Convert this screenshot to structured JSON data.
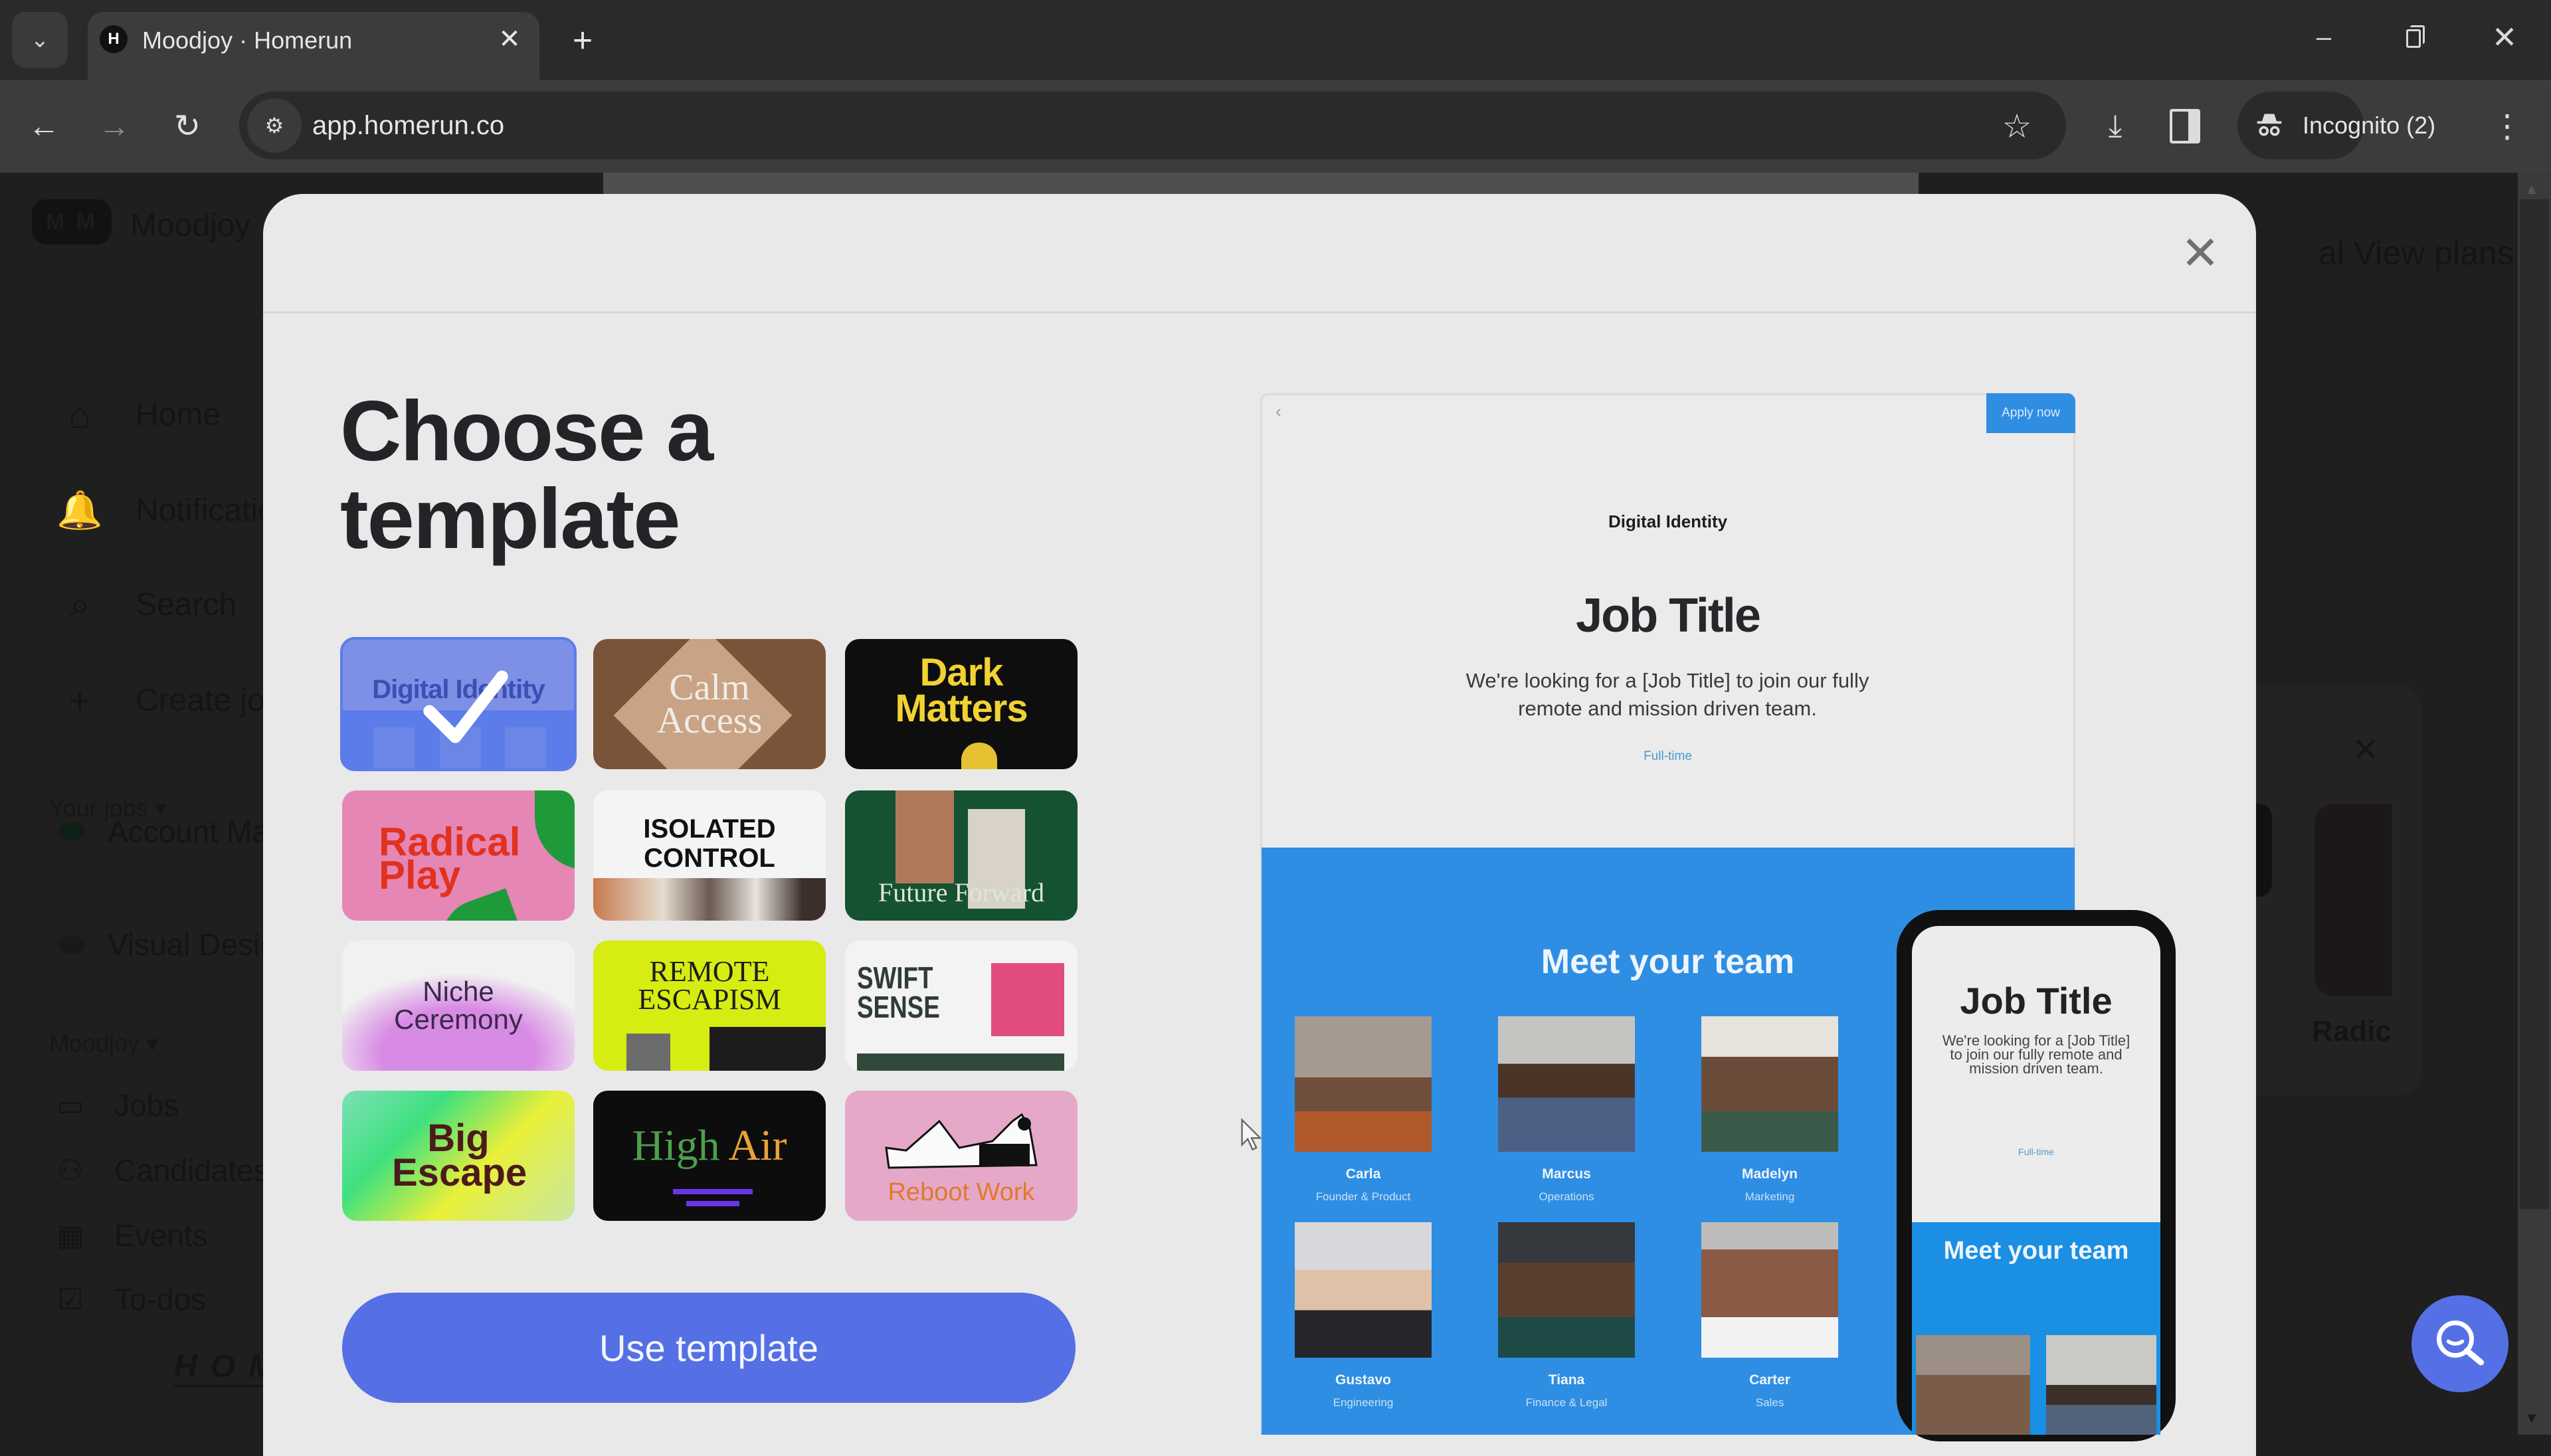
{
  "browser": {
    "tab_title": "Moodjoy · Homerun",
    "favicon_letter": "H",
    "url": "app.homerun.co",
    "incognito_label": "Incognito (2)",
    "icons": {
      "tab_list": "⌄",
      "tab_close": "✕",
      "new_tab": "+",
      "minimize": "–",
      "close": "✕",
      "back": "←",
      "forward": "→",
      "reload": "↻",
      "site_info": "⚙",
      "bookmark": "☆",
      "download": "⤓",
      "incognito": "🕵",
      "menu": "⋮"
    }
  },
  "app": {
    "logo_initials": "M M",
    "org_name": "Moodjoy",
    "nav": [
      {
        "icon": "⌂",
        "label": "Home"
      },
      {
        "icon": "🔔",
        "label": "Notifications"
      },
      {
        "icon": "⌕",
        "label": "Search"
      },
      {
        "icon": "+",
        "label": "Create job"
      }
    ],
    "your_jobs_label": "Your jobs ▾",
    "jobs": [
      {
        "label": "Account Manager"
      },
      {
        "label": "Visual Designer"
      }
    ],
    "org_section_label": "Moodjoy ▾",
    "org_nav": [
      {
        "icon": "▭",
        "label": "Jobs"
      },
      {
        "icon": "⚇",
        "label": "Candidates"
      },
      {
        "icon": "▦",
        "label": "Events"
      },
      {
        "icon": "☑",
        "label": "To-dos"
      }
    ],
    "footer_logo": "HOMERUN",
    "top_right_partial": "al   View plans",
    "right_panel_close": "✕",
    "right_panel_label": "Radic",
    "help_icon": "search-smile"
  },
  "modal": {
    "title": "Choose a template",
    "close_icon": "✕",
    "selected_index": 0,
    "templates": [
      {
        "name": "Digital Identity",
        "selected": true
      },
      {
        "name": "Calm Access",
        "selected": false
      },
      {
        "name": "Dark Matters",
        "selected": false
      },
      {
        "name": "Radical Play",
        "selected": false
      },
      {
        "name": "ISOLATED CONTROL",
        "selected": false
      },
      {
        "name": "Future Forward",
        "selected": false
      },
      {
        "name": "Niche Ceremony",
        "selected": false
      },
      {
        "name": "REMOTE ESCAPISM",
        "selected": false
      },
      {
        "name": "SWIFT SENSE",
        "selected": false
      },
      {
        "name": "Big Escape",
        "selected": false
      },
      {
        "name": "High Air",
        "name_part1": "High",
        "name_part2": "Air",
        "selected": false
      },
      {
        "name": "Reboot Work",
        "selected": false
      }
    ],
    "use_button": "Use template",
    "preview": {
      "back_icon": "‹",
      "apply_button": "Apply now",
      "brand": "Digital Identity",
      "job_title": "Job Title",
      "description": "We're looking for a [Job Title] to join our fully remote and mission driven team.",
      "employment_type": "Full-time",
      "team_heading": "Meet your team",
      "team": [
        {
          "name": "Carla",
          "role": "Founder & Product"
        },
        {
          "name": "Marcus",
          "role": "Operations"
        },
        {
          "name": "Madelyn",
          "role": "Marketing"
        },
        {
          "name": "Gustavo",
          "role": "Engineering"
        },
        {
          "name": "Tiana",
          "role": "Finance & Legal"
        },
        {
          "name": "Carter",
          "role": "Sales"
        }
      ],
      "mobile": {
        "job_title": "Job Title",
        "description": "We're looking for a [Job Title] to join our fully remote and mission driven team.",
        "employment_type": "Full-time",
        "team_heading": "Meet your team"
      }
    }
  },
  "colors": {
    "accent": "#5570e4",
    "preview_blue": "#2e8ee3",
    "modal_bg": "#e9e9e9",
    "chrome_dark": "#2a2a2a"
  }
}
